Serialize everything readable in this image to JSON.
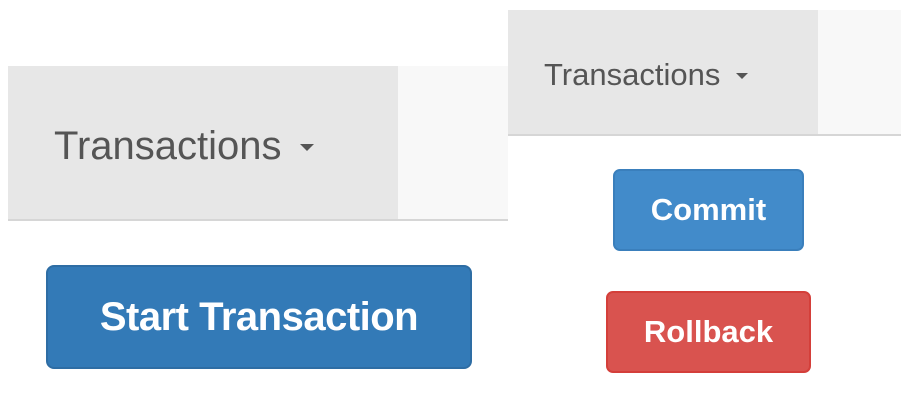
{
  "large_view": {
    "navbar": {
      "tab_label": "Transactions",
      "caret_icon": "caret-down-icon",
      "tab_background": "#e7e7e7",
      "navbar_background": "#f8f8f8"
    },
    "start_button": {
      "label": "Start Transaction",
      "color": "#337ab7"
    }
  },
  "small_view": {
    "navbar": {
      "tab_label": "Transactions",
      "caret_icon": "caret-down-icon",
      "tab_background": "#e7e7e7",
      "navbar_background": "#f8f8f8"
    },
    "commit_button": {
      "label": "Commit",
      "color": "#428bca"
    },
    "rollback_button": {
      "label": "Rollback",
      "color": "#d9534f"
    }
  }
}
